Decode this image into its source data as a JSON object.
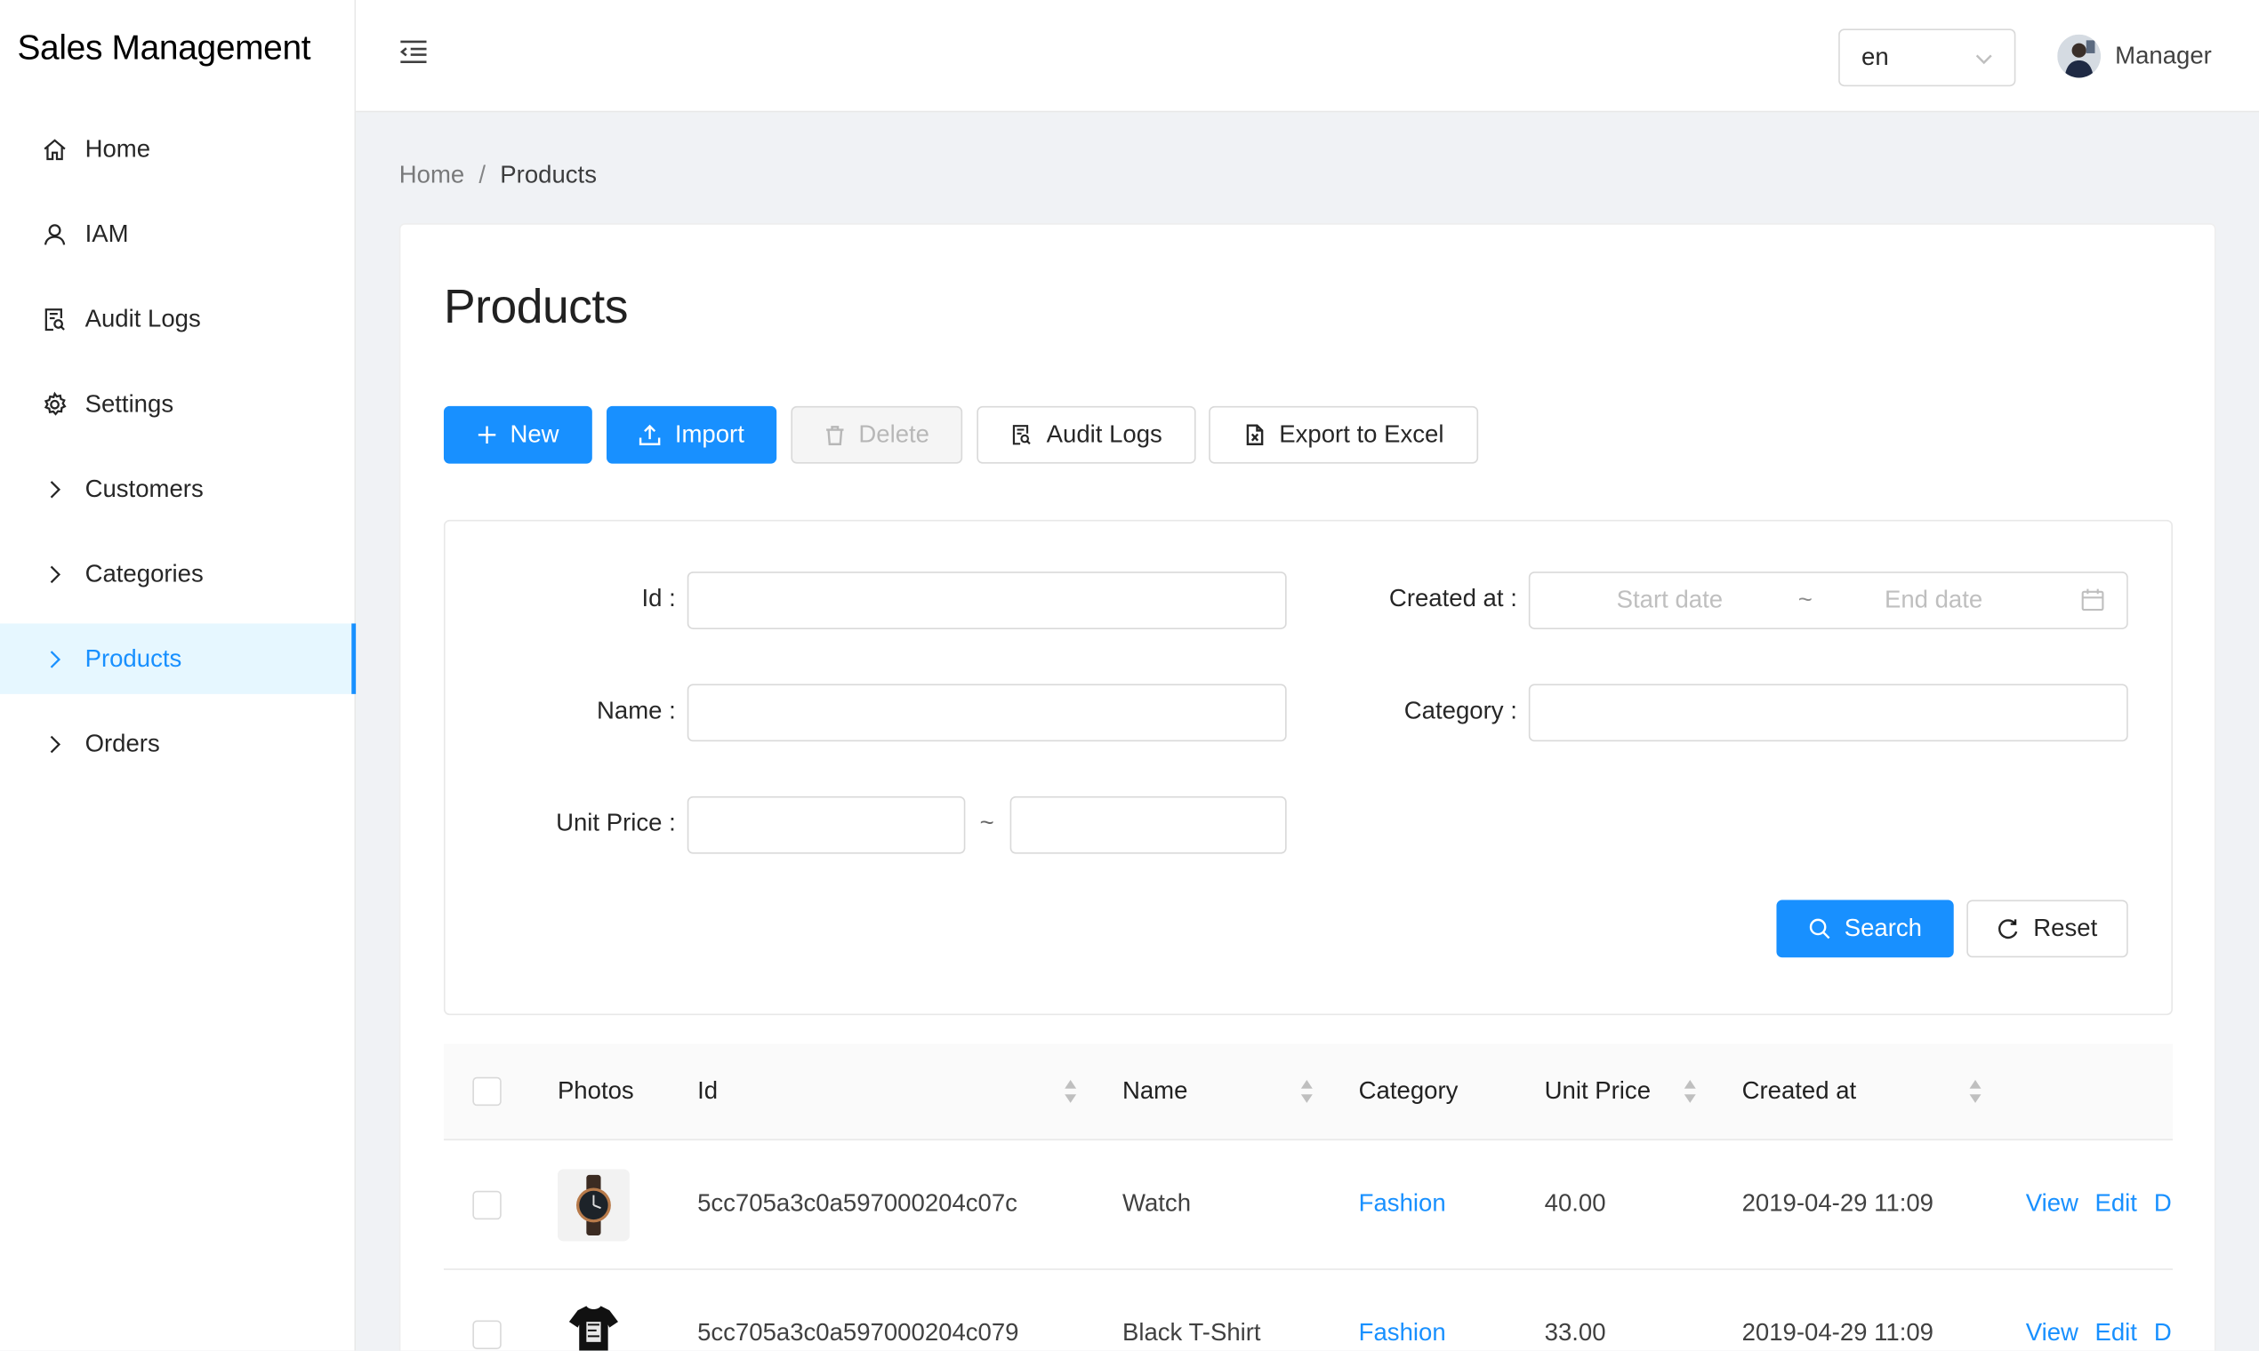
{
  "app": {
    "title": "Sales Management"
  },
  "sidebar": {
    "items": [
      {
        "label": "Home",
        "icon": "home-icon"
      },
      {
        "label": "IAM",
        "icon": "user-icon"
      },
      {
        "label": "Audit Logs",
        "icon": "file-search-icon"
      },
      {
        "label": "Settings",
        "icon": "gear-icon"
      },
      {
        "label": "Customers",
        "icon": "chevron-right-icon"
      },
      {
        "label": "Categories",
        "icon": "chevron-right-icon"
      },
      {
        "label": "Products",
        "icon": "chevron-right-icon",
        "active": true
      },
      {
        "label": "Orders",
        "icon": "chevron-right-icon"
      }
    ]
  },
  "header": {
    "language": "en",
    "user_name": "Manager"
  },
  "breadcrumb": {
    "home": "Home",
    "separator": "/",
    "current": "Products"
  },
  "page": {
    "title": "Products",
    "toolbar": {
      "new": "New",
      "import": "Import",
      "delete": "Delete",
      "audit_logs": "Audit Logs",
      "export": "Export to Excel"
    }
  },
  "filters": {
    "id_label": "Id",
    "id_value": "",
    "name_label": "Name",
    "name_value": "",
    "unit_price_label": "Unit Price",
    "unit_price_from": "",
    "unit_price_to": "",
    "range_sep": "~",
    "created_at_label": "Created at",
    "start_placeholder": "Start date",
    "end_placeholder": "End date",
    "category_label": "Category",
    "category_value": "",
    "search": "Search",
    "reset": "Reset"
  },
  "table": {
    "columns": [
      "Photos",
      "Id",
      "Name",
      "Category",
      "Unit Price",
      "Created at"
    ],
    "rows": [
      {
        "photo": "watch",
        "id": "5cc705a3c0a597000204c07c",
        "name": "Watch",
        "category": "Fashion",
        "unit_price": "40.00",
        "created_at": "2019-04-29 11:09"
      },
      {
        "photo": "black-t-shirt",
        "id": "5cc705a3c0a597000204c079",
        "name": "Black T-Shirt",
        "category": "Fashion",
        "unit_price": "33.00",
        "created_at": "2019-04-29 11:09"
      }
    ],
    "actions": {
      "view": "View",
      "edit": "Edit",
      "delete": "D"
    }
  },
  "colors": {
    "primary": "#1890ff",
    "active_menu_bg": "#e6f7ff",
    "page_bg": "#f0f2f5"
  }
}
